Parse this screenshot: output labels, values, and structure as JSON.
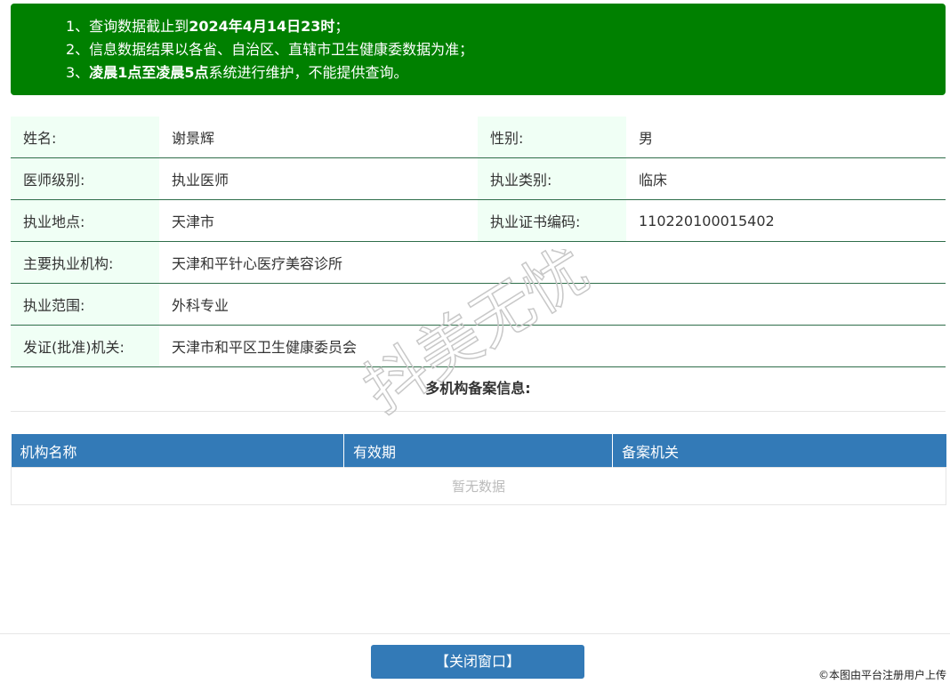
{
  "notice": {
    "line1_prefix": "1、查询数据截止到",
    "line1_bold": "2024年4月14日23时",
    "line1_suffix": "；",
    "line2": "2、信息数据结果以各省、自治区、直辖市卫生健康委数据为准；",
    "line3_prefix": "3、",
    "line3_bold": "凌晨1点至凌晨5点",
    "line3_suffix": "系统进行维护，不能提供查询。"
  },
  "info": {
    "name_label": "姓名:",
    "name_value": "谢景辉",
    "gender_label": "性别:",
    "gender_value": "男",
    "level_label": "医师级别:",
    "level_value": "执业医师",
    "category_label": "执业类别:",
    "category_value": "临床",
    "location_label": "执业地点:",
    "location_value": "天津市",
    "cert_label": "执业证书编码:",
    "cert_value": "110220100015402",
    "org_label": "主要执业机构:",
    "org_value": "天津和平针心医疗美容诊所",
    "scope_label": "执业范围:",
    "scope_value": "外科专业",
    "issuer_label": "发证(批准)机关:",
    "issuer_value": "天津市和平区卫生健康委员会"
  },
  "multi_org": {
    "title": "多机构备案信息:",
    "columns": [
      "机构名称",
      "有效期",
      "备案机关"
    ],
    "empty_text": "暂无数据"
  },
  "close_button": "【关闭窗口】",
  "watermark": "抖美无忧",
  "credit": "©本图由平台注册用户上传"
}
